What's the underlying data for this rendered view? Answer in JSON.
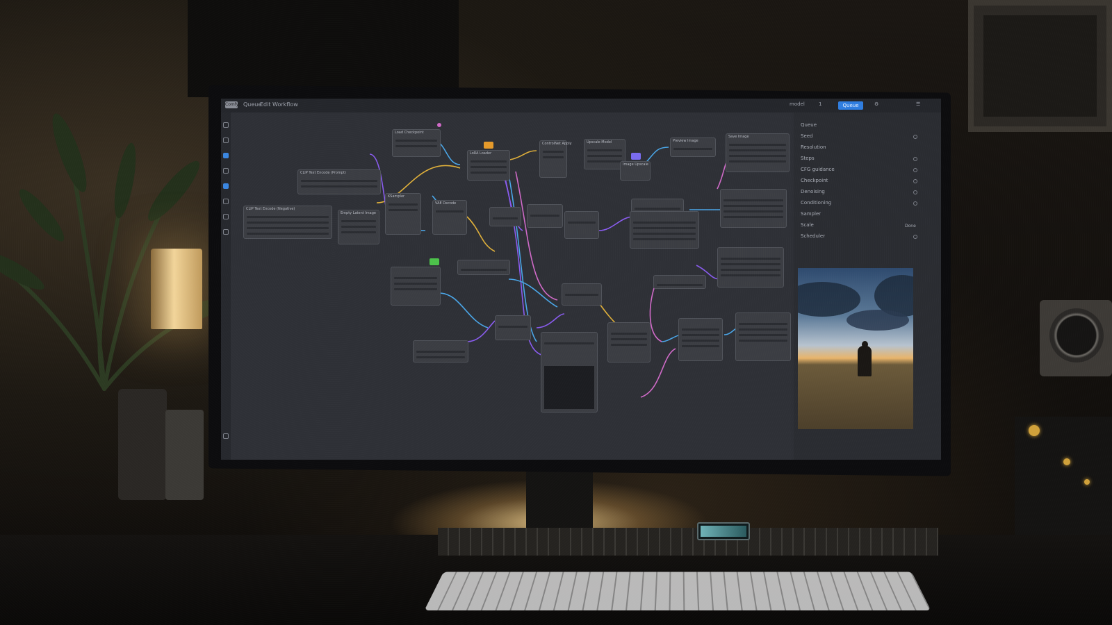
{
  "app": {
    "logo": "ComfyUI",
    "menu": [
      "Queue",
      "Edit",
      "Workflow"
    ]
  },
  "toolbar": {
    "run_label": "Queue",
    "queue_count": "1",
    "model_label": "model"
  },
  "nodes": [
    {
      "title": "Load Checkpoint"
    },
    {
      "title": "CLIP Text Encode (Prompt)"
    },
    {
      "title": "CLIP Text Encode (Negative)"
    },
    {
      "title": "Empty Latent Image"
    },
    {
      "title": "KSampler"
    },
    {
      "title": "VAE Decode"
    },
    {
      "title": "Save Image"
    },
    {
      "title": "LoRA Loader"
    },
    {
      "title": "ControlNet Apply"
    },
    {
      "title": "Upscale Model"
    },
    {
      "title": "Image Upscale"
    },
    {
      "title": "Preview Image"
    }
  ],
  "panel": {
    "items": [
      {
        "label": "Queue"
      },
      {
        "label": "Seed"
      },
      {
        "label": "Resolution"
      },
      {
        "label": "Steps"
      },
      {
        "label": "CFG guidance"
      },
      {
        "label": "Checkpoint"
      },
      {
        "label": "Denoising"
      },
      {
        "label": "Conditioning"
      },
      {
        "label": "Sampler"
      },
      {
        "label": "Scale"
      },
      {
        "label": "Scheduler"
      }
    ],
    "value_label": "Done"
  },
  "colors": {
    "accent": "#2f7de0",
    "wire_blue": "#4aa6e8",
    "wire_purple": "#8a5cf0",
    "wire_yellow": "#e0b03a",
    "wire_pink": "#d06ac8",
    "badge_orange": "#e59a2a",
    "badge_green": "#4cc24a",
    "badge_violet": "#7a6cf0"
  },
  "icons": {
    "sidebar": [
      "queue-icon",
      "node-library-icon",
      "model-library-icon",
      "workflows-icon",
      "templates-icon",
      "images-icon",
      "settings-icon"
    ]
  }
}
